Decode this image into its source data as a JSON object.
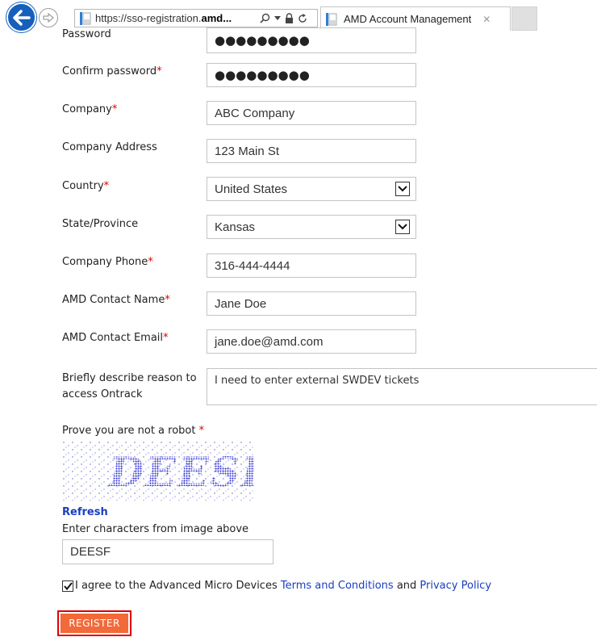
{
  "browser": {
    "address_prefix": "https://sso-registration.",
    "address_bold": "amd...",
    "tab_title": "AMD Account Management",
    "tab_close": "✕"
  },
  "form": {
    "password": {
      "label": "Password",
      "value": "●●●●●●●●●"
    },
    "confirm_password": {
      "label": "Confirm password",
      "required_mark": "*",
      "value": "●●●●●●●●●"
    },
    "company": {
      "label": "Company",
      "required_mark": "*",
      "value": "ABC Company"
    },
    "company_address": {
      "label": "Company Address",
      "value": "123 Main St"
    },
    "country": {
      "label": "Country",
      "required_mark": "*",
      "value": "United States"
    },
    "state": {
      "label": "State/Province",
      "value": "Kansas"
    },
    "company_phone": {
      "label": "Company Phone",
      "required_mark": "*",
      "value": "316-444-4444"
    },
    "amd_contact_name": {
      "label": "AMD Contact Name",
      "required_mark": "*",
      "value": "Jane Doe"
    },
    "amd_contact_email": {
      "label": "AMD Contact Email",
      "required_mark": "*",
      "value": "jane.doe@amd.com"
    },
    "reason": {
      "label_line1": "Briefly describe reason to",
      "label_line2": "access Ontrack",
      "value": "I need to enter external SWDEV tickets"
    },
    "captcha": {
      "label": "Prove you are not a robot",
      "required_mark": "*",
      "image_text": "DEESF",
      "refresh_label": "Refresh",
      "instruction": "Enter characters from image above",
      "value": "DEESF"
    },
    "agree": {
      "text_before": "I agree to the Advanced Micro Devices ",
      "terms_link": "Terms and Conditions",
      "text_middle": " and ",
      "privacy_link": "Privacy Policy",
      "checked": true
    },
    "register_label": "REGISTER"
  },
  "colors": {
    "back_button": "#1560bd",
    "required": "#e00000",
    "link": "#1a3dbf",
    "register_button": "#f26a3a",
    "highlight_border": "#e00000",
    "captcha_text": "#2a2ad0"
  }
}
